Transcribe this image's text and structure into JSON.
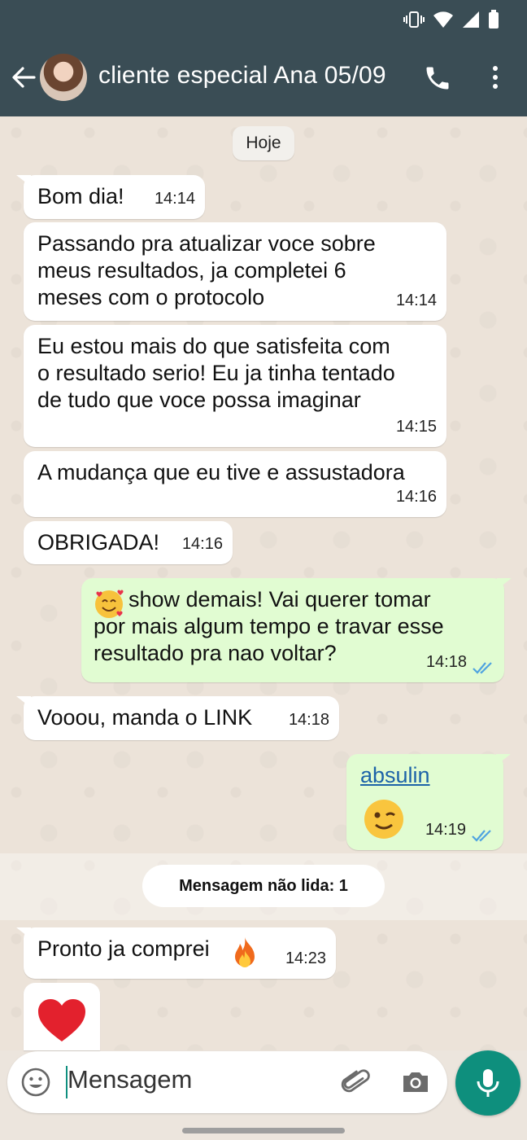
{
  "header": {
    "contact_name": "cliente especial Ana 05/09",
    "bg_color": "#3a4d55"
  },
  "icons": {
    "back": "arrow-left-icon",
    "call": "phone-icon",
    "menu": "more-vertical-icon",
    "emoji": "emoji-icon",
    "attach": "paperclip-icon",
    "camera": "camera-icon",
    "mic": "microphone-icon"
  },
  "chat": {
    "date_label": "Hoje",
    "messages": [
      {
        "dir": "in",
        "text": "Bom dia!",
        "time": "14:14"
      },
      {
        "dir": "in",
        "text": "Passando pra atualizar voce sobre\nmeus resultados, ja completei 6\nmeses com o protocolo",
        "time": "14:14"
      },
      {
        "dir": "in",
        "text": "Eu estou mais do que satisfeita com\no resultado serio! Eu ja tinha tentado\nde tudo que voce possa imaginar",
        "time": "14:15"
      },
      {
        "dir": "in",
        "text": "A mudança que eu tive e assustadora",
        "time": "14:16"
      },
      {
        "dir": "in",
        "text": "OBRIGADA!",
        "time": "14:16"
      },
      {
        "dir": "out",
        "text": "show demais! Vai querer tomar\npor mais algum tempo e travar esse\nresultado pra nao voltar?",
        "time": "14:18",
        "read": true
      },
      {
        "dir": "in",
        "text": "Vooou, manda o LINK",
        "time": "14:18"
      },
      {
        "dir": "out",
        "link": "absulin",
        "time": "14:19",
        "read": true
      },
      {
        "dir": "in",
        "text": "Pronto ja comprei",
        "time": "14:23"
      }
    ],
    "unread_label": "Mensagem não lida: 1"
  },
  "input": {
    "placeholder": "Mensagem"
  },
  "colors": {
    "outgoing_bubble": "#e1fcd2",
    "incoming_bubble": "#ffffff",
    "accent": "#0e8f7d",
    "read_ticks": "#4fa3e0"
  }
}
